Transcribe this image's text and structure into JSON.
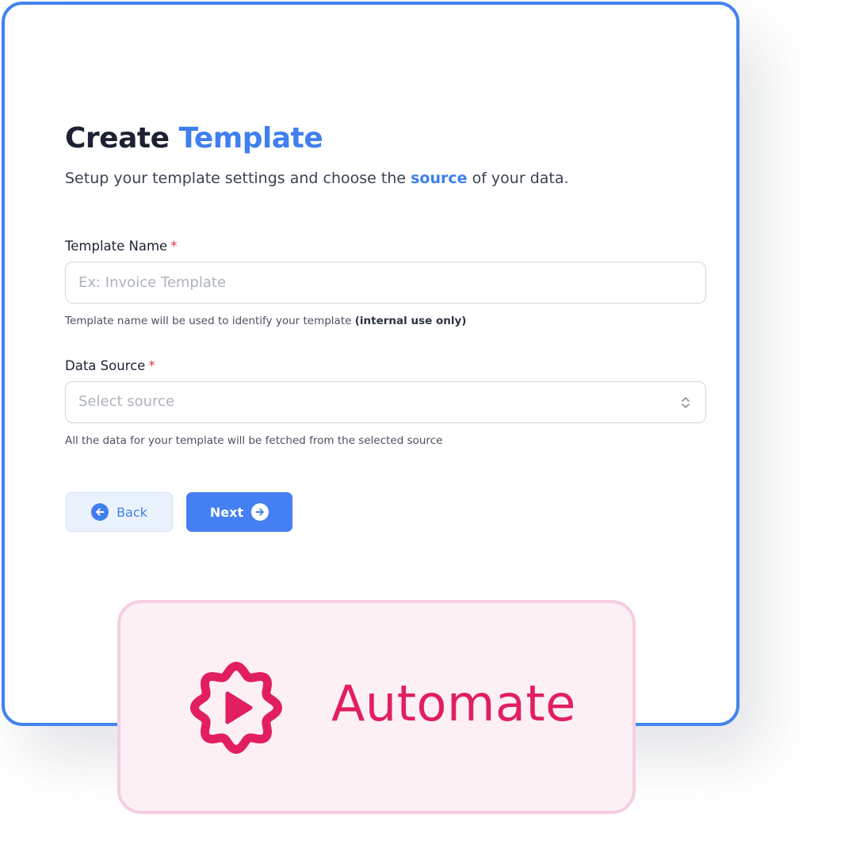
{
  "form": {
    "title_part1": "Create",
    "title_part2": "Template",
    "subtitle_part1": "Setup your template settings and choose the",
    "subtitle_accent": "source",
    "subtitle_part2": "of your data.",
    "template_name": {
      "label": "Template Name",
      "required_mark": "*",
      "value": "",
      "placeholder": "Ex: Invoice Template",
      "hint": "Template name will be used to identify your template",
      "hint_bold": "(internal use only)"
    },
    "data_source": {
      "label": "Data Source",
      "required_mark": "*",
      "placeholder": "Select source",
      "hint": "All the data for your template will be fetched from the selected source"
    },
    "back_button": "Back",
    "next_button": "Next"
  },
  "badge": {
    "brand_text": "Automate"
  },
  "colors": {
    "accent_blue": "#3f7ff0",
    "card_border": "#4483ee",
    "required_red": "#e0334d",
    "brand_pink": "#e21e62",
    "badge_background": "#fcf0f5"
  },
  "icons": {
    "back": "arrow-left-circle-icon",
    "next": "arrow-right-circle-icon",
    "select": "chevron-up-down-icon",
    "logo": "gear-play-icon"
  }
}
